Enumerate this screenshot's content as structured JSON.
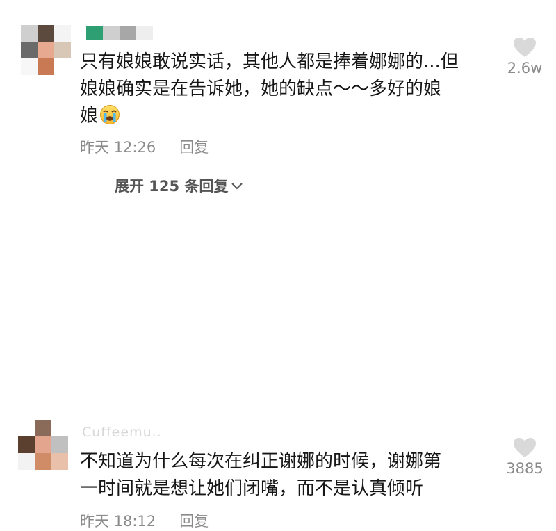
{
  "comments": [
    {
      "username_partial": "",
      "text": "只有娘娘敢说实话，其他人都是捧着娜娜的...但\n娘娘确实是在告诉她，她的缺点～～多好的娘\n娘",
      "emoji": "crying-face",
      "time": "昨天 12:26",
      "reply_label": "回复",
      "likes": "2.6w"
    },
    {
      "username_partial": "Cuffeemu..",
      "text": "不知道为什么每次在纠正谢娜的时候，谢娜第\n一时间就是想让她们闭嘴，而不是认真倾听",
      "time": "昨天 18:12",
      "reply_label": "回复",
      "likes": "3885"
    }
  ],
  "expand_replies": "展开 125 条回复",
  "colors": {
    "text": "#161616",
    "muted": "#8a8a8a",
    "heart": "#d9d9d9",
    "expand": "#555555"
  }
}
